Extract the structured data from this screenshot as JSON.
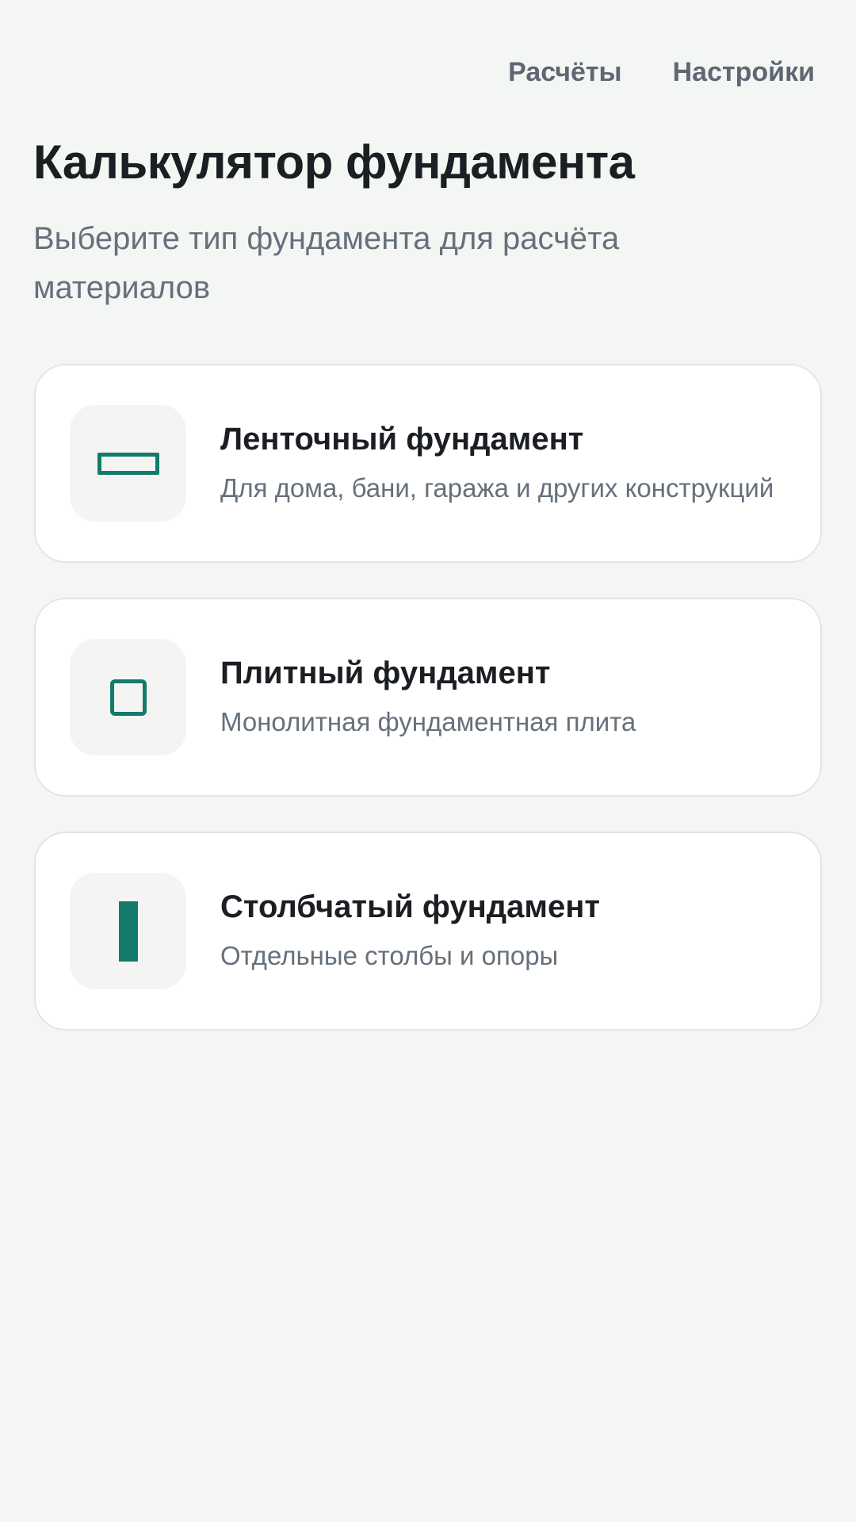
{
  "nav": {
    "calculations": "Расчёты",
    "settings": "Настройки"
  },
  "header": {
    "title": "Калькулятор фундамента",
    "subtitle": "Выберите тип фундамента для расчёта материалов"
  },
  "foundations": [
    {
      "title": "Ленточный фундамент",
      "description": "Для дома, бани, гаража и других конструкций",
      "icon": "strip-foundation-icon"
    },
    {
      "title": "Плитный фундамент",
      "description": "Монолитная фундаментная плита",
      "icon": "slab-foundation-icon"
    },
    {
      "title": "Столбчатый фундамент",
      "description": "Отдельные столбы и опоры",
      "icon": "pillar-foundation-icon"
    }
  ],
  "colors": {
    "accent": "#147A6B",
    "background": "#F4F6F4",
    "card": "#FFFFFF",
    "text_primary": "#1B1E22",
    "text_secondary": "#66707B"
  }
}
